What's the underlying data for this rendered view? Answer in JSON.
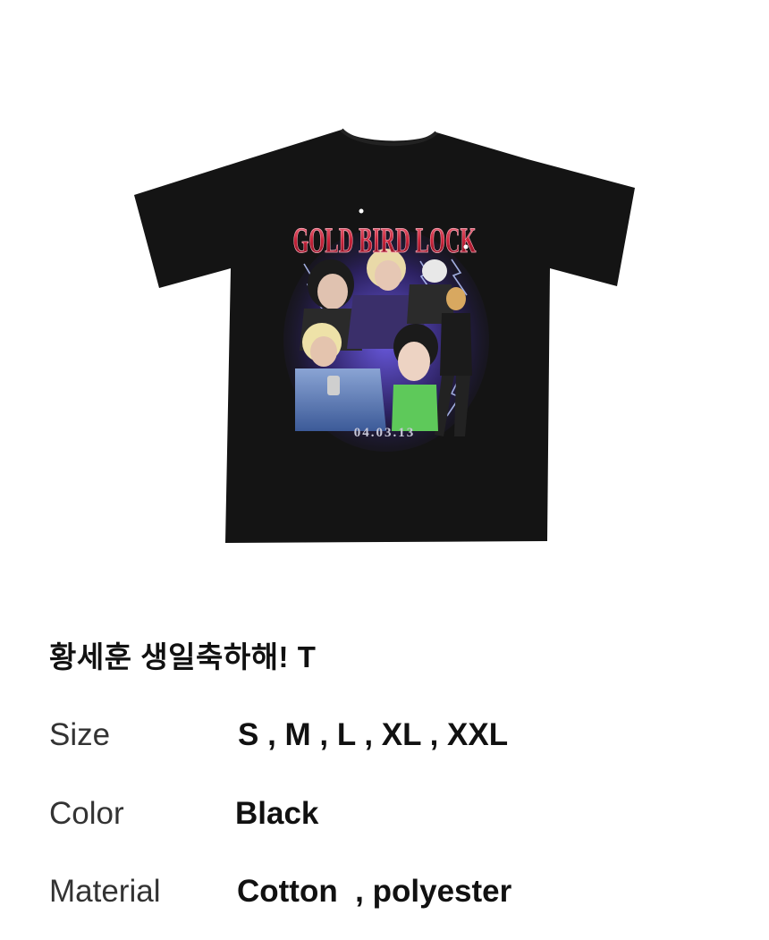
{
  "product": {
    "image_alt": "black t-shirt graphic print",
    "print": {
      "logo_text": "GOLD BIRD LOCK",
      "date_text": "04.03.13"
    },
    "title": "황세훈 생일축하해! T",
    "specs": {
      "size": {
        "label": "Size",
        "value": "S , M , L , XL , XXL"
      },
      "color": {
        "label": "Color",
        "value": "Black"
      },
      "material": {
        "label": "Material",
        "value": "Cotton  , polyester"
      }
    }
  },
  "colors": {
    "shirt": "#141414",
    "logo_red": "#c9243a",
    "print_purple": "#3a2a7a",
    "print_blue": "#4a6ad0",
    "print_green": "#5ec95a",
    "text_primary": "#111111",
    "text_label": "#333333",
    "background": "#ffffff"
  }
}
